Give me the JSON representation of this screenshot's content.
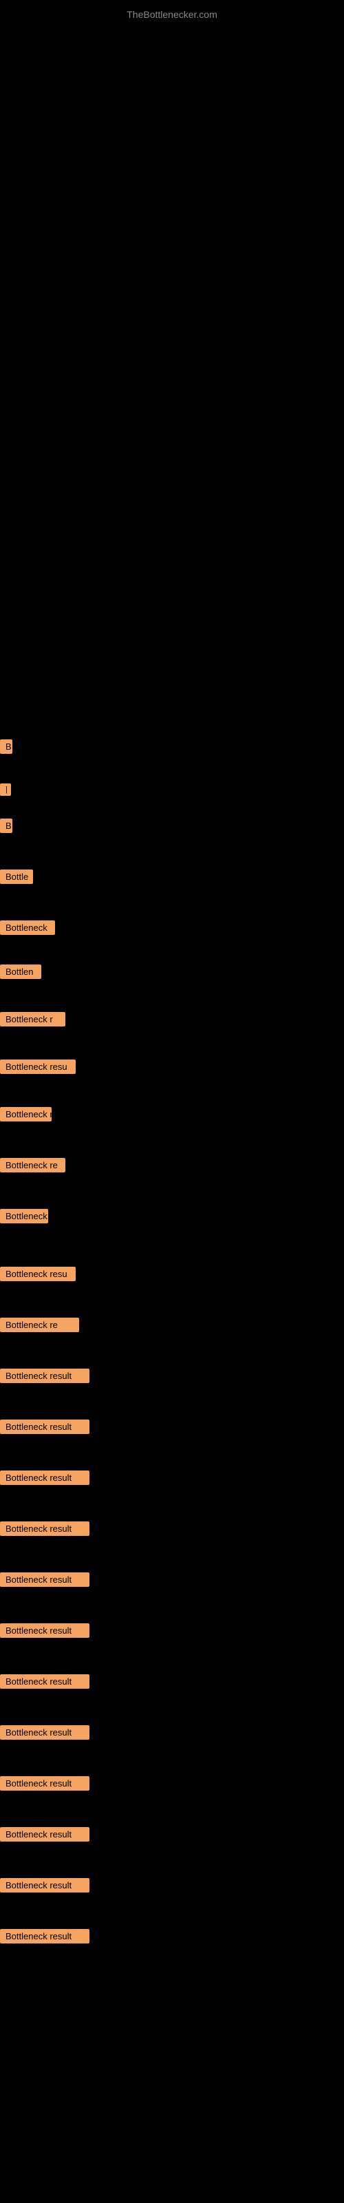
{
  "site": {
    "title": "TheBottlenecker.com"
  },
  "items": [
    {
      "id": 1,
      "label": "B",
      "row_class": "row-1"
    },
    {
      "id": 2,
      "label": "|",
      "row_class": "row-2"
    },
    {
      "id": 3,
      "label": "B",
      "row_class": "row-3"
    },
    {
      "id": 4,
      "label": "Bottle",
      "row_class": "row-4"
    },
    {
      "id": 5,
      "label": "Bottleneck",
      "row_class": "row-5"
    },
    {
      "id": 6,
      "label": "Bottlen",
      "row_class": "row-6"
    },
    {
      "id": 7,
      "label": "Bottleneck r",
      "row_class": "row-7"
    },
    {
      "id": 8,
      "label": "Bottleneck resu",
      "row_class": "row-8"
    },
    {
      "id": 9,
      "label": "Bottleneck r",
      "row_class": "row-9"
    },
    {
      "id": 10,
      "label": "Bottleneck re",
      "row_class": "row-10"
    },
    {
      "id": 11,
      "label": "Bottleneck",
      "row_class": "row-11"
    },
    {
      "id": 12,
      "label": "Bottleneck resu",
      "row_class": "row-12"
    },
    {
      "id": 13,
      "label": "Bottleneck re",
      "row_class": "row-13"
    },
    {
      "id": 14,
      "label": "Bottleneck result",
      "row_class": "row-full"
    },
    {
      "id": 15,
      "label": "Bottleneck result",
      "row_class": "row-full"
    },
    {
      "id": 16,
      "label": "Bottleneck result",
      "row_class": "row-full"
    },
    {
      "id": 17,
      "label": "Bottleneck result",
      "row_class": "row-full"
    },
    {
      "id": 18,
      "label": "Bottleneck result",
      "row_class": "row-full"
    },
    {
      "id": 19,
      "label": "Bottleneck result",
      "row_class": "row-full"
    },
    {
      "id": 20,
      "label": "Bottleneck result",
      "row_class": "row-full"
    },
    {
      "id": 21,
      "label": "Bottleneck result",
      "row_class": "row-full"
    },
    {
      "id": 22,
      "label": "Bottleneck result",
      "row_class": "row-full"
    },
    {
      "id": 23,
      "label": "Bottleneck result",
      "row_class": "row-full"
    },
    {
      "id": 24,
      "label": "Bottleneck result",
      "row_class": "row-full"
    },
    {
      "id": 25,
      "label": "Bottleneck result",
      "row_class": "row-full"
    }
  ],
  "colors": {
    "background": "#000000",
    "label_bg": "#f4a460",
    "label_text": "#000000",
    "site_title": "#888888"
  }
}
